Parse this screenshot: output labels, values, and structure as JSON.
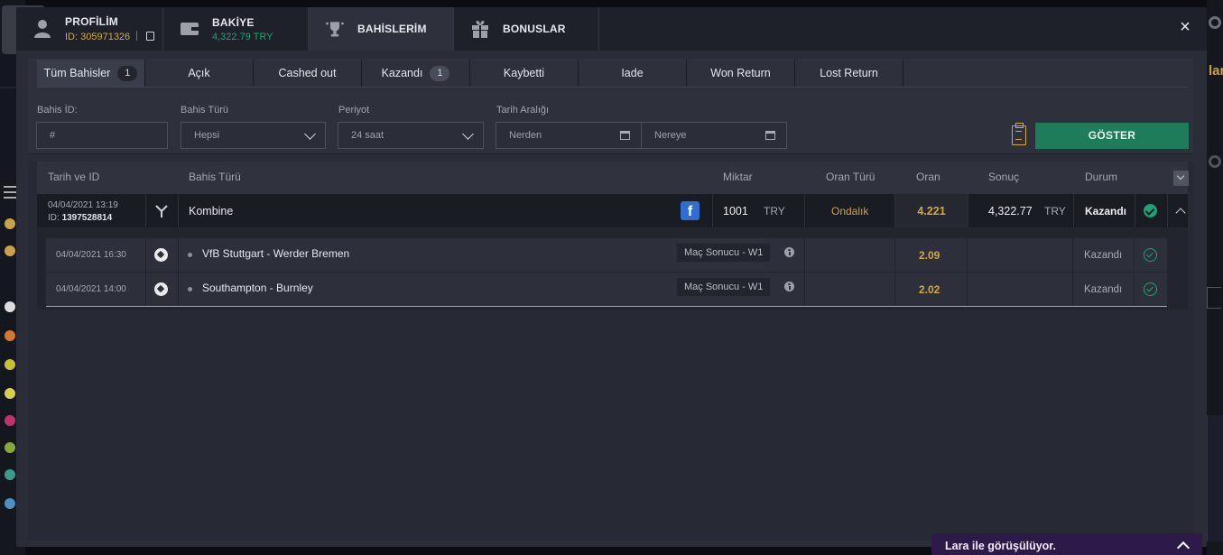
{
  "header_tabs": [
    {
      "title": "PROFİLİM",
      "sub": "ID: 305971326"
    },
    {
      "title": "BAKİYE",
      "sub": "4,322.79 TRY"
    },
    {
      "title": "BAHİSLERİM"
    },
    {
      "title": "BONUSLAR"
    }
  ],
  "close_label": "×",
  "sub_tabs": [
    {
      "label": "Tüm Bahisler",
      "count": "1"
    },
    {
      "label": "Açık"
    },
    {
      "label": "Cashed out"
    },
    {
      "label": "Kazandı",
      "count": "1"
    },
    {
      "label": "Kaybetti"
    },
    {
      "label": "Iade"
    },
    {
      "label": "Won Return"
    },
    {
      "label": "Lost Return"
    }
  ],
  "filters": {
    "bet_id_label": "Bahis İD:",
    "bet_id_placeholder": "#",
    "bet_type_label": "Bahis Türü",
    "bet_type_value": "Hepsi",
    "period_label": "Periyot",
    "period_value": "24 saat",
    "date_range_label": "Tarih Aralığı",
    "from_placeholder": "Nerden",
    "to_placeholder": "Nereye",
    "show_button": "GÖSTER"
  },
  "table": {
    "headers": [
      "Tarih ve ID",
      "Bahis Türü",
      "Miktar",
      "Oran Türü",
      "Oran",
      "Sonuç",
      "Durum"
    ],
    "bet": {
      "date": "04/04/2021 13:19",
      "id_prefix": "ID:",
      "id": "1397528814",
      "type": "Kombine",
      "amount": "1001",
      "currency": "TRY",
      "odds_type": "Ondalık",
      "odds": "4.221",
      "result": "4,322.77",
      "result_currency": "TRY",
      "status": "Kazandı"
    },
    "selections": [
      {
        "date": "04/04/2021 16:30",
        "match": "VfB Stuttgart - Werder Bremen",
        "market": "Maç Sonucu - W1",
        "odds": "2.09",
        "status": "Kazandı"
      },
      {
        "date": "04/04/2021 14:00",
        "match": "Southampton - Burnley",
        "market": "Maç Sonucu - W1",
        "odds": "2.02",
        "status": "Kazandı"
      }
    ]
  },
  "chat": {
    "label": "Lara ile görüşülüyor."
  },
  "background": {
    "right_text": "lar"
  },
  "colors": {
    "accent_gold": "#d4a93a",
    "accent_green": "#1fa271",
    "button_green": "#1e7c5a"
  }
}
